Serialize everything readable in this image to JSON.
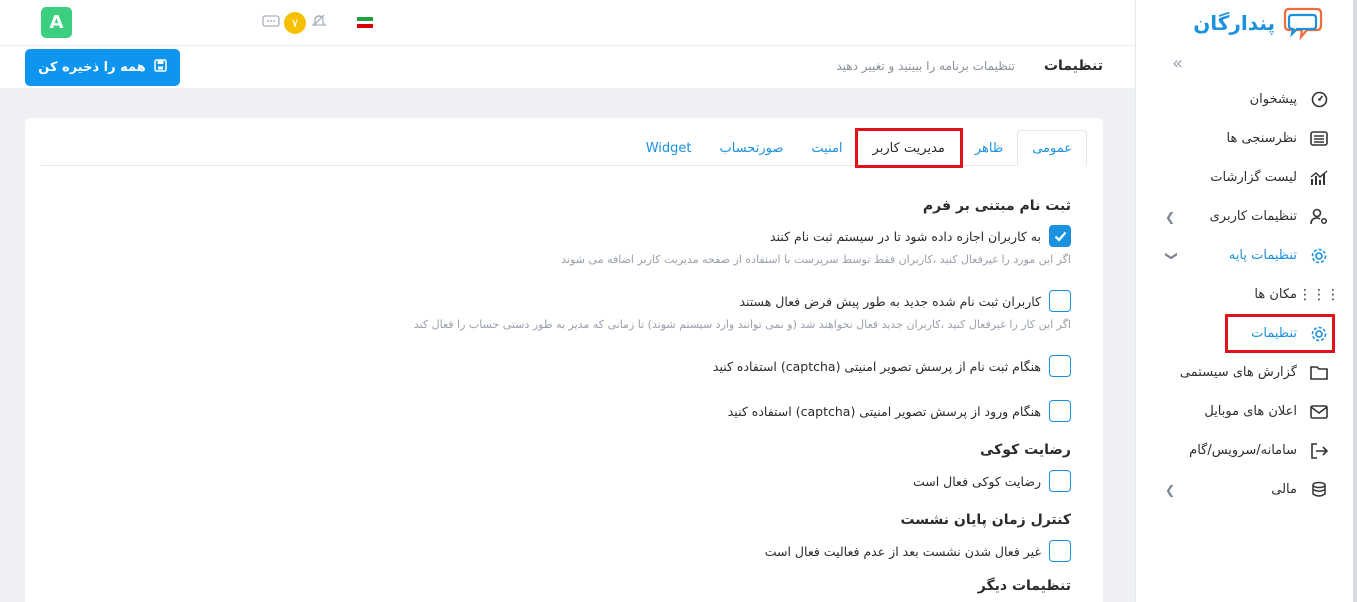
{
  "brand": {
    "name": "پندارگان",
    "color": "#1a92e0"
  },
  "user": {
    "avatar_letter": "A"
  },
  "header": {
    "notification_count": "۷"
  },
  "page": {
    "title": "تنظیمات",
    "subtitle": "تنظیمات برنامه را ببینید و تغییر دهید",
    "save_all_label": "همه را ذخیره کن"
  },
  "sidebar": {
    "items": [
      {
        "label": "پیشخوان",
        "icon": "dashboard-icon"
      },
      {
        "label": "نظرسنجی ها",
        "icon": "list-icon"
      },
      {
        "label": "لیست گزارشات",
        "icon": "chart-icon"
      },
      {
        "label": "تنظیمات کاربری",
        "icon": "user-gear-icon",
        "expandable": true
      },
      {
        "label": "تنظیمات پایه",
        "icon": "gear-icon",
        "expanded": true
      },
      {
        "label": "مکان ها",
        "icon": "dots-icon"
      },
      {
        "label": "تنظیمات",
        "icon": "gear-icon",
        "active": true
      },
      {
        "label": "گزارش های سیستمی",
        "icon": "folder-icon"
      },
      {
        "label": "اعلان های موبایل",
        "icon": "mail-icon"
      },
      {
        "label": "سامانه/سرویس/گام",
        "icon": "exit-icon"
      },
      {
        "label": "مالی",
        "icon": "coins-icon",
        "expandable": true
      }
    ]
  },
  "tabs": [
    {
      "label": "عمومی",
      "active": true
    },
    {
      "label": "ظاهر"
    },
    {
      "label": "مدیریت کاربر",
      "highlighted": true
    },
    {
      "label": "امنیت"
    },
    {
      "label": "صورتحساب"
    },
    {
      "label": "Widget"
    }
  ],
  "sections": {
    "registration": {
      "title": "ثبت نام مبتنی بر فرم",
      "opt1_label": "به کاربران اجازه داده شود تا در سیستم ثبت نام کنند",
      "opt1_checked": true,
      "opt1_hint": "اگر این مورد را غیرفعال کنید ،کاربران فقط توسط سرپرست با استفاده از صفحه مدیریت کاربر اضافه می شوند",
      "opt2_label": "کاربران ثبت نام شده جدید به طور پیش فرض فعال هستند",
      "opt2_hint": "اگر این کار را غیرفعال کنید ،کاربران جدید فعال نخواهند شد (و نمی توانند وارد سیستم شوند) تا زمانی که مدیر به طور دستی حساب را فعال کند",
      "opt3_label": "هنگام ثبت نام از پرسش تصویر امنیتی (captcha) استفاده کنید",
      "opt4_label": "هنگام ورود از پرسش تصویر امنیتی (captcha) استفاده کنید"
    },
    "cookie": {
      "title": "رضایت کوکی",
      "opt_label": "رضایت کوکی فعال است"
    },
    "session": {
      "title": "کنترل زمان پایان نشست",
      "opt_label": "غیر فعال شدن نشست بعد از عدم فعالیت فعال است"
    },
    "other": {
      "title": "تنظیمات دیگر"
    }
  },
  "colors": {
    "accent": "#1a92e0",
    "highlight": "#e0121c",
    "save_button": "#0d95ef"
  }
}
